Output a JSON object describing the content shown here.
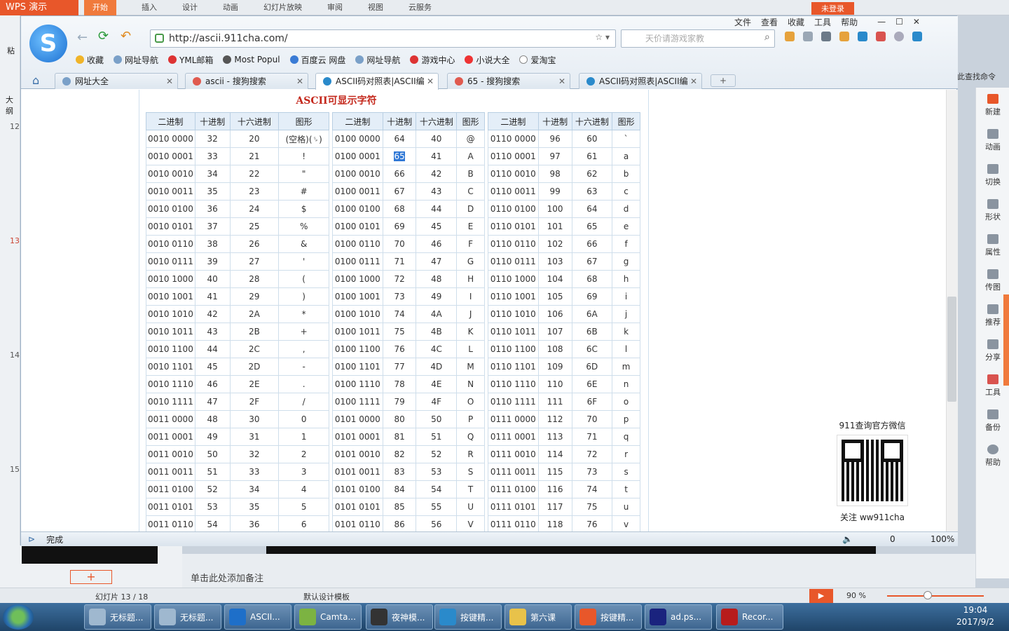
{
  "wps": {
    "app_title": "WPS 演示",
    "ribbon": [
      "开始",
      "插入",
      "设计",
      "动画",
      "幻灯片放映",
      "审阅",
      "视图",
      "云服务"
    ],
    "login": "未登录",
    "right_tools": [
      "新建",
      "动画",
      "切换",
      "形状",
      "属性",
      "传图",
      "推荐",
      "分享",
      "工具",
      "备份",
      "帮助"
    ],
    "right_hint": "此查找命令",
    "left_marks": [
      "粘",
      "大纲",
      "12",
      "13",
      "14",
      "15"
    ],
    "notes_placeholder": "单击此处添加备注",
    "status_slide": "幻灯片 13 / 18",
    "status_template": "默认设计模板",
    "zoom": "90 %"
  },
  "browser": {
    "menu": [
      "文件",
      "查看",
      "收藏",
      "工具",
      "帮助"
    ],
    "url": "http://ascii.911cha.com/",
    "search_placeholder": "天价请游戏家教",
    "bookmarks": [
      "收藏",
      "网址导航",
      "YML邮箱",
      "Most Popul",
      "百度云 网盘",
      "网址导航",
      "游戏中心",
      "小说大全",
      "爱淘宝"
    ],
    "tabs": [
      "网址大全",
      "ascii - 搜狗搜索",
      "ASCII码对照表|ASCII编",
      "65 - 搜狗搜索",
      "ASCII码对照表|ASCII编"
    ],
    "status_left": "完成",
    "status_right": [
      "0",
      "100%"
    ]
  },
  "page": {
    "title": "ASCII可显示字符",
    "headers": [
      "二进制",
      "十进制",
      "十六进制",
      "图形"
    ],
    "qr_caption": "911查询官方微信",
    "qr_follow": "关注 ww911cha",
    "table1": [
      [
        "0010 0000",
        "32",
        "20",
        "(空格)(␠)"
      ],
      [
        "0010 0001",
        "33",
        "21",
        "!"
      ],
      [
        "0010 0010",
        "34",
        "22",
        "\""
      ],
      [
        "0010 0011",
        "35",
        "23",
        "#"
      ],
      [
        "0010 0100",
        "36",
        "24",
        "$"
      ],
      [
        "0010 0101",
        "37",
        "25",
        "%"
      ],
      [
        "0010 0110",
        "38",
        "26",
        "&"
      ],
      [
        "0010 0111",
        "39",
        "27",
        "'"
      ],
      [
        "0010 1000",
        "40",
        "28",
        "("
      ],
      [
        "0010 1001",
        "41",
        "29",
        ")"
      ],
      [
        "0010 1010",
        "42",
        "2A",
        "*"
      ],
      [
        "0010 1011",
        "43",
        "2B",
        "+"
      ],
      [
        "0010 1100",
        "44",
        "2C",
        ","
      ],
      [
        "0010 1101",
        "45",
        "2D",
        "-"
      ],
      [
        "0010 1110",
        "46",
        "2E",
        "."
      ],
      [
        "0010 1111",
        "47",
        "2F",
        "/"
      ],
      [
        "0011 0000",
        "48",
        "30",
        "0"
      ],
      [
        "0011 0001",
        "49",
        "31",
        "1"
      ],
      [
        "0011 0010",
        "50",
        "32",
        "2"
      ],
      [
        "0011 0011",
        "51",
        "33",
        "3"
      ],
      [
        "0011 0100",
        "52",
        "34",
        "4"
      ],
      [
        "0011 0101",
        "53",
        "35",
        "5"
      ],
      [
        "0011 0110",
        "54",
        "36",
        "6"
      ]
    ],
    "table2": [
      [
        "0100 0000",
        "64",
        "40",
        "@"
      ],
      [
        "0100 0001",
        "65",
        "41",
        "A"
      ],
      [
        "0100 0010",
        "66",
        "42",
        "B"
      ],
      [
        "0100 0011",
        "67",
        "43",
        "C"
      ],
      [
        "0100 0100",
        "68",
        "44",
        "D"
      ],
      [
        "0100 0101",
        "69",
        "45",
        "E"
      ],
      [
        "0100 0110",
        "70",
        "46",
        "F"
      ],
      [
        "0100 0111",
        "71",
        "47",
        "G"
      ],
      [
        "0100 1000",
        "72",
        "48",
        "H"
      ],
      [
        "0100 1001",
        "73",
        "49",
        "I"
      ],
      [
        "0100 1010",
        "74",
        "4A",
        "J"
      ],
      [
        "0100 1011",
        "75",
        "4B",
        "K"
      ],
      [
        "0100 1100",
        "76",
        "4C",
        "L"
      ],
      [
        "0100 1101",
        "77",
        "4D",
        "M"
      ],
      [
        "0100 1110",
        "78",
        "4E",
        "N"
      ],
      [
        "0100 1111",
        "79",
        "4F",
        "O"
      ],
      [
        "0101 0000",
        "80",
        "50",
        "P"
      ],
      [
        "0101 0001",
        "81",
        "51",
        "Q"
      ],
      [
        "0101 0010",
        "82",
        "52",
        "R"
      ],
      [
        "0101 0011",
        "83",
        "53",
        "S"
      ],
      [
        "0101 0100",
        "84",
        "54",
        "T"
      ],
      [
        "0101 0101",
        "85",
        "55",
        "U"
      ],
      [
        "0101 0110",
        "86",
        "56",
        "V"
      ]
    ],
    "table3": [
      [
        "0110 0000",
        "96",
        "60",
        "`"
      ],
      [
        "0110 0001",
        "97",
        "61",
        "a"
      ],
      [
        "0110 0010",
        "98",
        "62",
        "b"
      ],
      [
        "0110 0011",
        "99",
        "63",
        "c"
      ],
      [
        "0110 0100",
        "100",
        "64",
        "d"
      ],
      [
        "0110 0101",
        "101",
        "65",
        "e"
      ],
      [
        "0110 0110",
        "102",
        "66",
        "f"
      ],
      [
        "0110 0111",
        "103",
        "67",
        "g"
      ],
      [
        "0110 1000",
        "104",
        "68",
        "h"
      ],
      [
        "0110 1001",
        "105",
        "69",
        "i"
      ],
      [
        "0110 1010",
        "106",
        "6A",
        "j"
      ],
      [
        "0110 1011",
        "107",
        "6B",
        "k"
      ],
      [
        "0110 1100",
        "108",
        "6C",
        "l"
      ],
      [
        "0110 1101",
        "109",
        "6D",
        "m"
      ],
      [
        "0110 1110",
        "110",
        "6E",
        "n"
      ],
      [
        "0110 1111",
        "111",
        "6F",
        "o"
      ],
      [
        "0111 0000",
        "112",
        "70",
        "p"
      ],
      [
        "0111 0001",
        "113",
        "71",
        "q"
      ],
      [
        "0111 0010",
        "114",
        "72",
        "r"
      ],
      [
        "0111 0011",
        "115",
        "73",
        "s"
      ],
      [
        "0111 0100",
        "116",
        "74",
        "t"
      ],
      [
        "0111 0101",
        "117",
        "75",
        "u"
      ],
      [
        "0111 0110",
        "118",
        "76",
        "v"
      ]
    ]
  },
  "taskbar": {
    "items": [
      "无标题...",
      "无标题...",
      "ASCII...",
      "Camta...",
      "夜神模...",
      "按键精...",
      "第六课",
      "按键精...",
      "ad.ps...",
      "Recor..."
    ],
    "time": "19:04",
    "date": "2017/9/2"
  }
}
